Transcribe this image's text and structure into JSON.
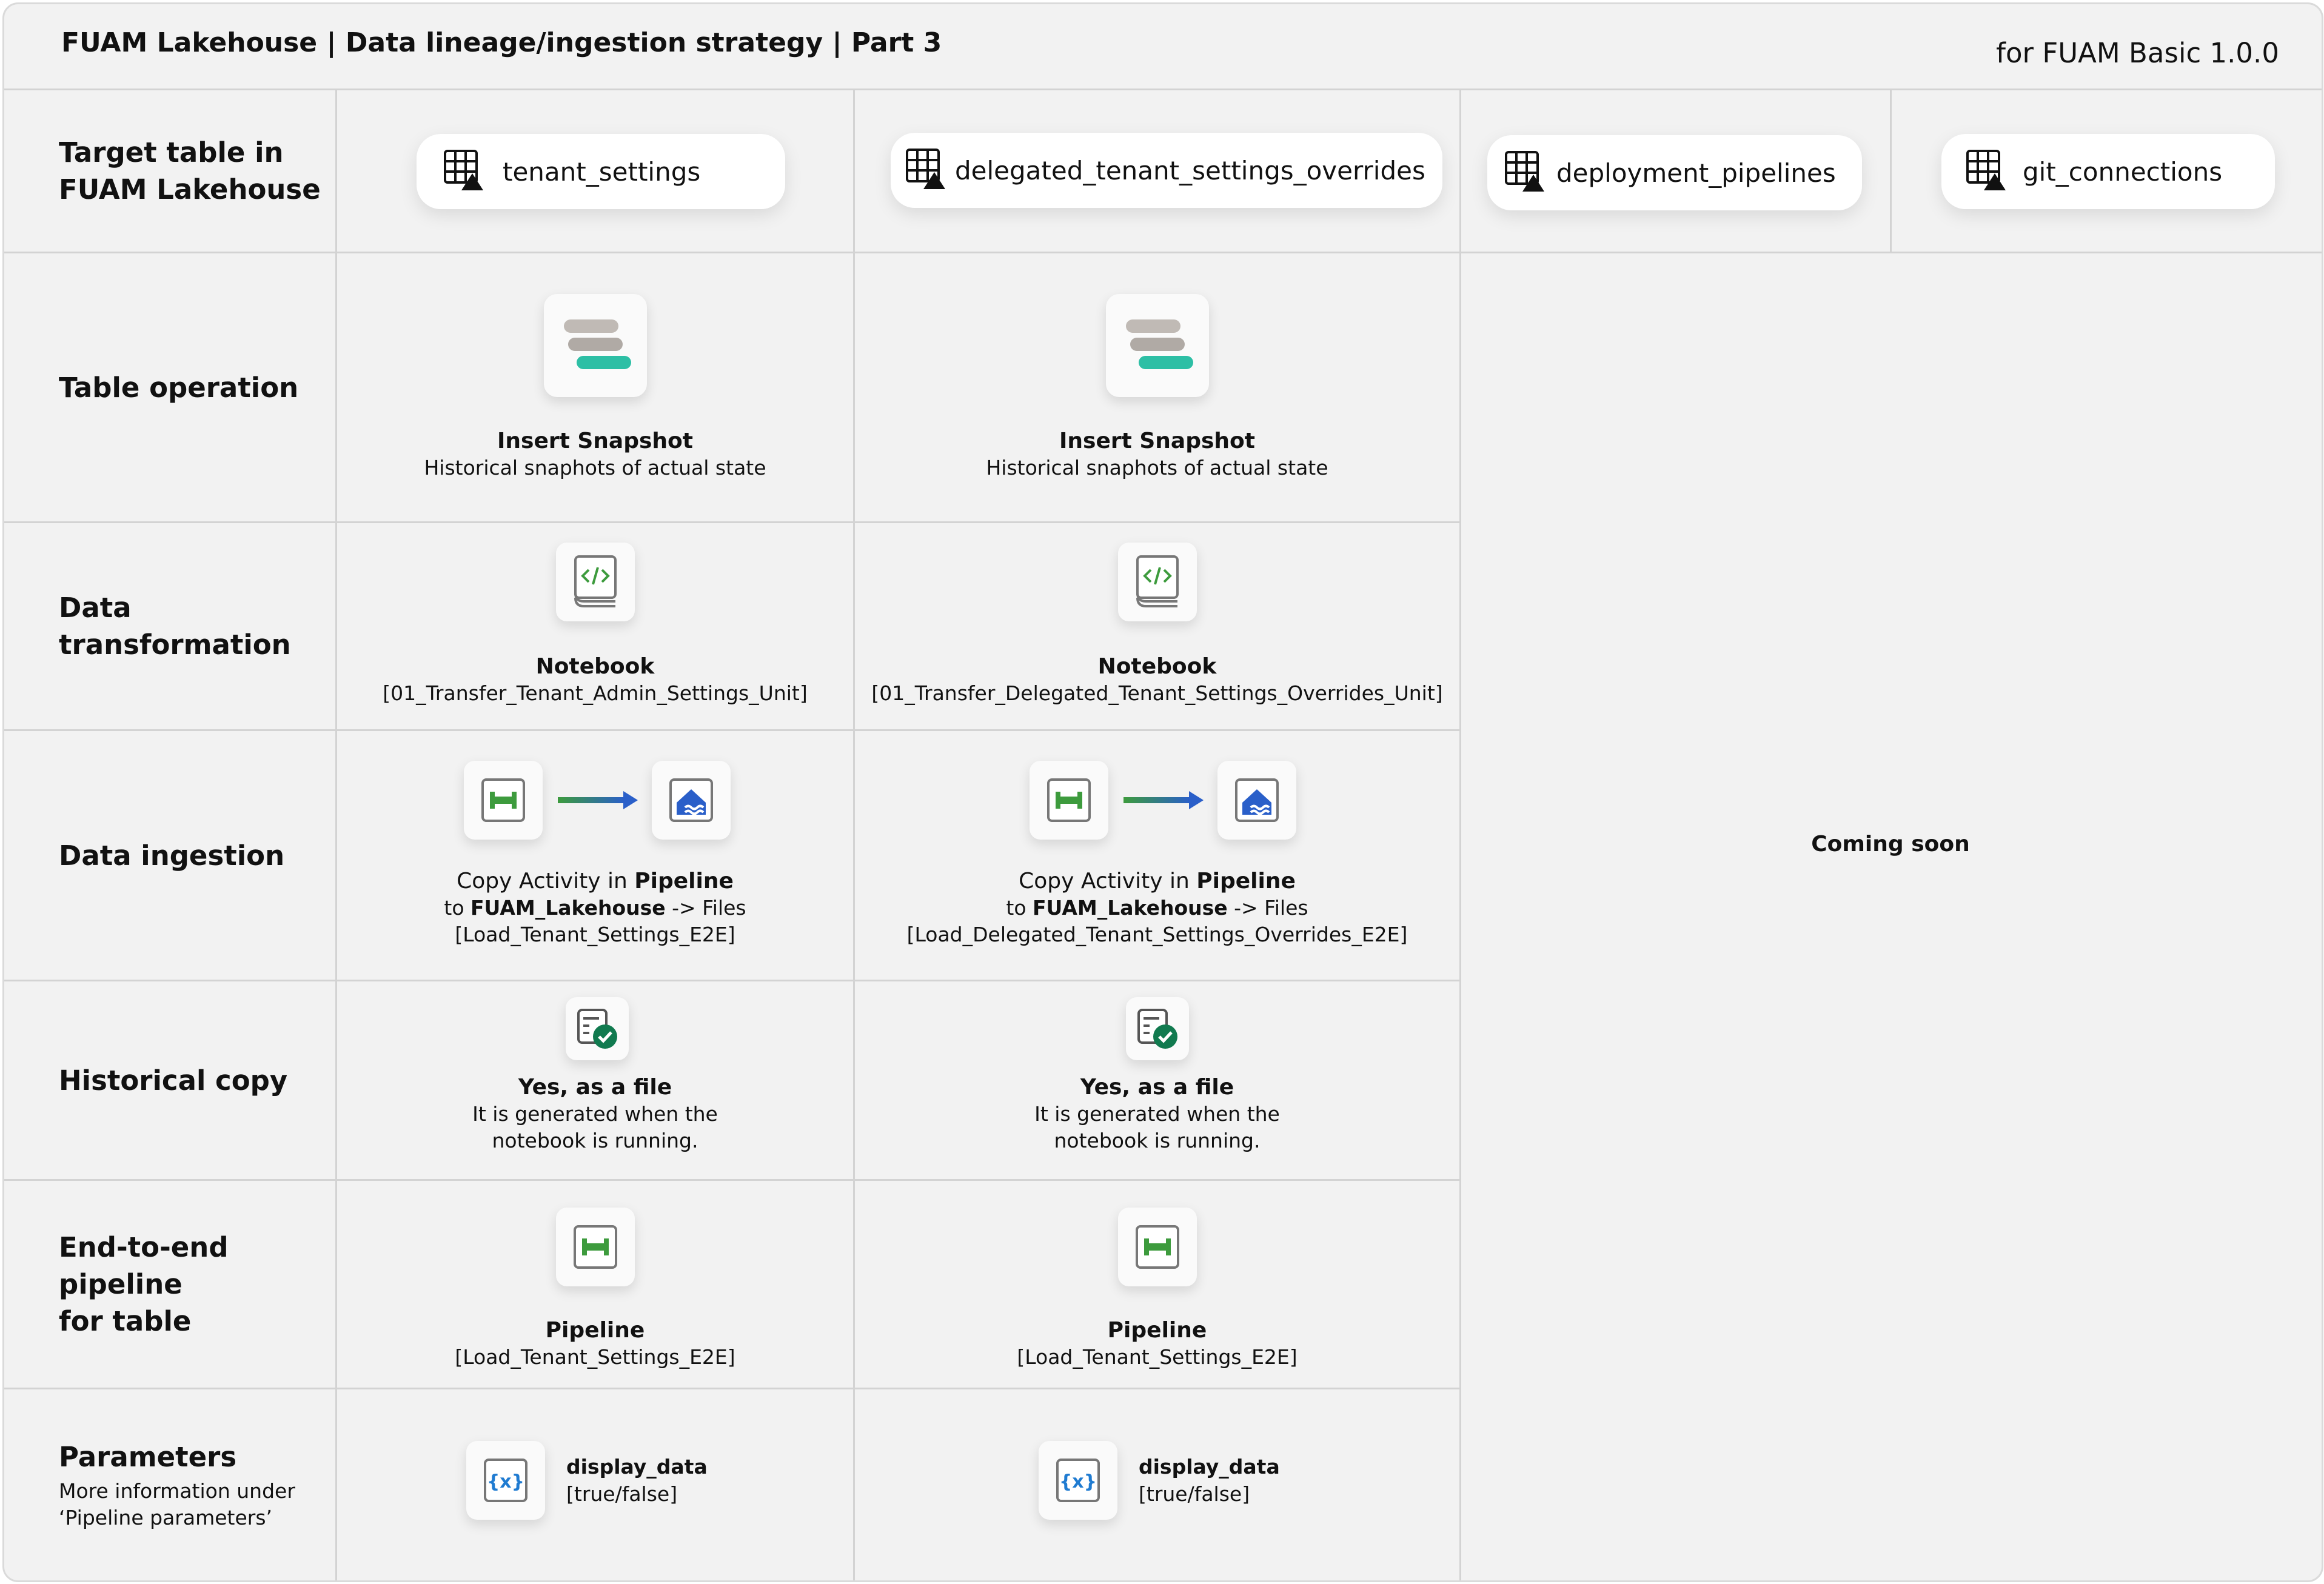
{
  "header": {
    "title": "FUAM Lakehouse | Data lineage/ingestion strategy | Part 3",
    "version": "for FUAM Basic 1.0.0"
  },
  "rows": {
    "target": "Target table in\nFUAM Lakehouse",
    "operation": "Table operation",
    "transformation": "Data\ntransformation",
    "ingestion": "Data ingestion",
    "historical": "Historical copy",
    "pipeline": "End-to-end\npipeline\nfor table",
    "parameters": "Parameters",
    "parameters_sub": "More information under\n‘Pipeline parameters’"
  },
  "tables": [
    {
      "name": "tenant_settings",
      "operation_title": "Insert Snapshot",
      "operation_desc": "Historical snaphots of actual state",
      "notebook_title": "Notebook",
      "notebook_name": "[01_Transfer_Tenant_Admin_Settings_Unit]",
      "copy_prefix": "Copy Activity in ",
      "copy_bold": "Pipeline",
      "to_prefix": "to ",
      "to_bold": "FUAM_Lakehouse",
      "to_suffix": " -> Files",
      "copy_pipeline": "[Load_Tenant_Settings_E2E]",
      "hist_title": "Yes, as a file",
      "hist_desc_1": "It is generated when the",
      "hist_desc_2": "notebook is running.",
      "e2e_title": "Pipeline",
      "e2e_name": "[Load_Tenant_Settings_E2E]",
      "param_name": "display_data",
      "param_values": "[true/false]"
    },
    {
      "name": "delegated_tenant_settings_overrides",
      "operation_title": "Insert Snapshot",
      "operation_desc": "Historical snaphots of actual state",
      "notebook_title": "Notebook",
      "notebook_name": "[01_Transfer_Delegated_Tenant_Settings_Overrides_Unit]",
      "copy_prefix": "Copy Activity in ",
      "copy_bold": "Pipeline",
      "to_prefix": "to ",
      "to_bold": "FUAM_Lakehouse",
      "to_suffix": " -> Files",
      "copy_pipeline": "[Load_Delegated_Tenant_Settings_Overrides_E2E]",
      "hist_title": "Yes, as a file",
      "hist_desc_1": "It is generated when the",
      "hist_desc_2": "notebook is running.",
      "e2e_title": "Pipeline",
      "e2e_name": "[Load_Tenant_Settings_E2E]",
      "param_name": "display_data",
      "param_values": "[true/false]"
    },
    {
      "name": "deployment_pipelines"
    },
    {
      "name": "git_connections"
    }
  ],
  "coming_soon": "Coming soon",
  "colors": {
    "background": "#f2f2f2",
    "grid_line": "#d3d3d3",
    "teal": "#2dbfa5",
    "green": "#3d9b3d",
    "blue": "#2a5fc9",
    "check_green": "#117a4f"
  }
}
